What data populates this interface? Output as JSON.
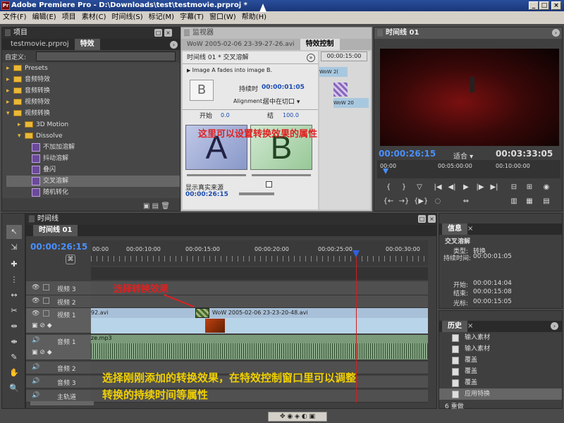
{
  "window": {
    "title": "Adobe Premiere Pro - D:\\Downloads\\test\\testmovie.prproj *",
    "app_icon": "Pr"
  },
  "menu": [
    "文件(F)",
    "编辑(E)",
    "项目",
    "素材(C)",
    "时间线(S)",
    "标记(M)",
    "字幕(T)",
    "窗口(W)",
    "帮助(H)"
  ],
  "project_panel": {
    "title": "项目",
    "tabs": [
      "testmovie.prproj",
      "特效"
    ],
    "custom_label": "自定义:",
    "tree": [
      {
        "label": "Presets",
        "level": 0,
        "type": "folder"
      },
      {
        "label": "音频特效",
        "level": 0,
        "type": "folder"
      },
      {
        "label": "音频转换",
        "level": 0,
        "type": "folder"
      },
      {
        "label": "视频特效",
        "level": 0,
        "type": "folder"
      },
      {
        "label": "视频转换",
        "level": 0,
        "type": "folder"
      },
      {
        "label": "3D Motion",
        "level": 1,
        "type": "folder"
      },
      {
        "label": "Dissolve",
        "level": 1,
        "type": "folder"
      },
      {
        "label": "不加加溶解",
        "level": 2,
        "type": "transition"
      },
      {
        "label": "抖动溶解",
        "level": 2,
        "type": "transition"
      },
      {
        "label": "叠闪",
        "level": 2,
        "type": "transition"
      },
      {
        "label": "交叉溶解",
        "level": 2,
        "type": "transition",
        "selected": true
      },
      {
        "label": "随机转化",
        "level": 2,
        "type": "transition"
      }
    ]
  },
  "effect_panel": {
    "title": "监视器",
    "tabs": [
      "WoW 2005-02-06 23-39-27-26.avi",
      "特效控制"
    ],
    "header": "时间线 01 * 交叉溶解",
    "timecode_top": "00:00:15:00",
    "description": "Image A fades into image B.",
    "duration_label": "持续时",
    "duration_value": "00:00:01:05",
    "alignment_label": "Alignment:",
    "alignment_value": "居中在切口",
    "start_label": "开始",
    "start_value": "0.0",
    "end_label": "结",
    "end_value": "100.0",
    "overlay_text": "这里可以设置转换效果的属性",
    "preview_a": "A",
    "preview_b": "B",
    "preview_thumb": "B",
    "show_source_label": "显示真实来源",
    "current_tc": "00:00:26:15",
    "mini_clips": [
      "WoW 2(",
      "WoW 20"
    ]
  },
  "monitor": {
    "title": "时间线 01",
    "current": "00:00:26:15",
    "fit": "适合",
    "duration": "00:03:33:05",
    "ruler": [
      "00:00",
      "00:05:00:00",
      "00:10:00:00"
    ]
  },
  "timeline": {
    "title": "时间线",
    "tab": "时间线 01",
    "current": "00:00:26:15",
    "ruler": [
      "00:00",
      "00:00:10:00",
      "00:00:15:00",
      "00:00:20:00",
      "00:00:25:00",
      "00:00:30:00"
    ],
    "tracks": [
      {
        "label": "视频 3"
      },
      {
        "label": "视频 2"
      },
      {
        "label": "视频 1"
      },
      {
        "label": "音频 1"
      },
      {
        "label": "音频 2"
      },
      {
        "label": "音频 3"
      },
      {
        "label": "主轨道"
      }
    ],
    "clip_v1_left": "92.avi",
    "clip_v1_right": "WoW 2005-02-06 23-23-20-48.avi",
    "clip_a1": "ze.mp3",
    "annotation_select": "选择转换效果",
    "caption_line1": "选择刚刚添加的转换效果，在特效控制窗口里可以调整",
    "caption_line2": "转换的持续时间等属性"
  },
  "info_panel": {
    "title": "信息",
    "name": "交叉溶解",
    "type_label": "类型:",
    "type_value": "转换",
    "dur_label": "持续时间:",
    "dur_value": "00:00:01:05",
    "start_label": "开始:",
    "start_value": "00:00:14:04",
    "end_label": "结束:",
    "end_value": "00:00:15:08",
    "cursor_label": "光标:",
    "cursor_value": "00:00:15:05"
  },
  "history_panel": {
    "title": "历史",
    "items": [
      "输入素材",
      "输入素材",
      "覆盖",
      "覆盖",
      "覆盖",
      "应用特换"
    ],
    "footer": "6 重做"
  },
  "colors": {
    "accent": "#4a90ff",
    "annotation": "#e02020",
    "caption": "#f0d000",
    "playhead": "#3060e0"
  }
}
